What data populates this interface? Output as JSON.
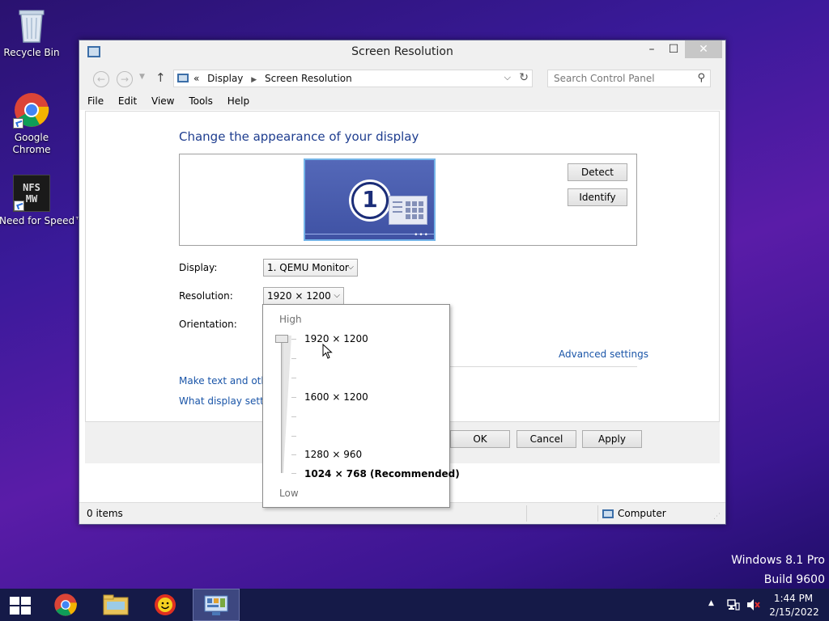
{
  "desktop": {
    "icons": [
      {
        "label": "Recycle Bin"
      },
      {
        "label": "Google Chrome"
      },
      {
        "label": "Need for Speed™ Mo..."
      }
    ],
    "nfs_logo_text": "NFS MW",
    "watermark": {
      "line1": "Windows 8.1 Pro",
      "line2": "Build 9600"
    }
  },
  "window": {
    "title": "Screen Resolution",
    "controls": {
      "minimize": "–",
      "maximize": "☐",
      "close": "✕"
    },
    "breadcrumb": {
      "prefix": "«",
      "items": [
        "Display",
        "Screen Resolution"
      ]
    },
    "search": {
      "placeholder": "Search Control Panel"
    },
    "menu": [
      "File",
      "Edit",
      "View",
      "Tools",
      "Help"
    ],
    "heading": "Change the appearance of your display",
    "monitor_number": "1",
    "buttons": {
      "detect": "Detect",
      "identify": "Identify",
      "ok": "OK",
      "cancel": "Cancel",
      "apply": "Apply"
    },
    "fields": {
      "display_label": "Display:",
      "display_value": "1. QEMU Monitor",
      "resolution_label": "Resolution:",
      "resolution_value": "1920 × 1200",
      "orientation_label": "Orientation:"
    },
    "links": {
      "advanced": "Advanced settings",
      "make_text": "Make text and other",
      "what_display": "What display setting"
    },
    "status": {
      "items": "0 items",
      "computer": "Computer"
    }
  },
  "resolution_popup": {
    "high": "High",
    "low": "Low",
    "options": [
      "1920 × 1200",
      "1600 × 1200",
      "1280 × 960",
      "1024 × 768 (Recommended)"
    ],
    "selected": "1920 × 1200"
  },
  "taskbar": {
    "clock_time": "1:44 PM",
    "clock_date": "2/15/2022",
    "tray_expand": "▲"
  },
  "colors": {
    "accent_link": "#1a55a8",
    "heading": "#1e3d8f",
    "taskbar": "#151a48"
  }
}
